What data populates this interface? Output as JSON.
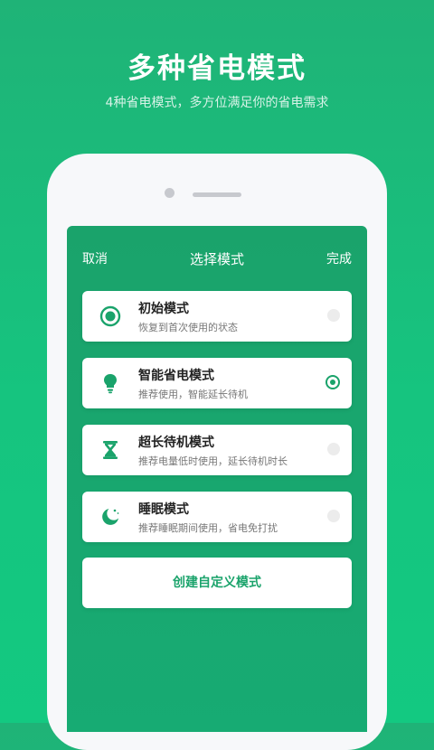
{
  "hero": {
    "title": "多种省电模式",
    "subtitle": "4种省电模式，多方位满足你的省电需求"
  },
  "dialog": {
    "cancel_label": "取消",
    "title": "选择模式",
    "done_label": "完成",
    "modes": [
      {
        "title": "初始模式",
        "desc": "恢复到首次使用的状态",
        "icon": "target-icon",
        "selected": false
      },
      {
        "title": "智能省电模式",
        "desc": "推荐使用，智能延长待机",
        "icon": "lightbulb-icon",
        "selected": true
      },
      {
        "title": "超长待机模式",
        "desc": "推荐电量低时使用，延长待机时长",
        "icon": "hourglass-icon",
        "selected": false
      },
      {
        "title": "睡眠模式",
        "desc": "推荐睡眠期间使用，省电免打扰",
        "icon": "moon-icon",
        "selected": false
      }
    ],
    "create_label": "创建自定义模式"
  },
  "colors": {
    "accent": "#1aa36b",
    "background": "#16c47f"
  }
}
